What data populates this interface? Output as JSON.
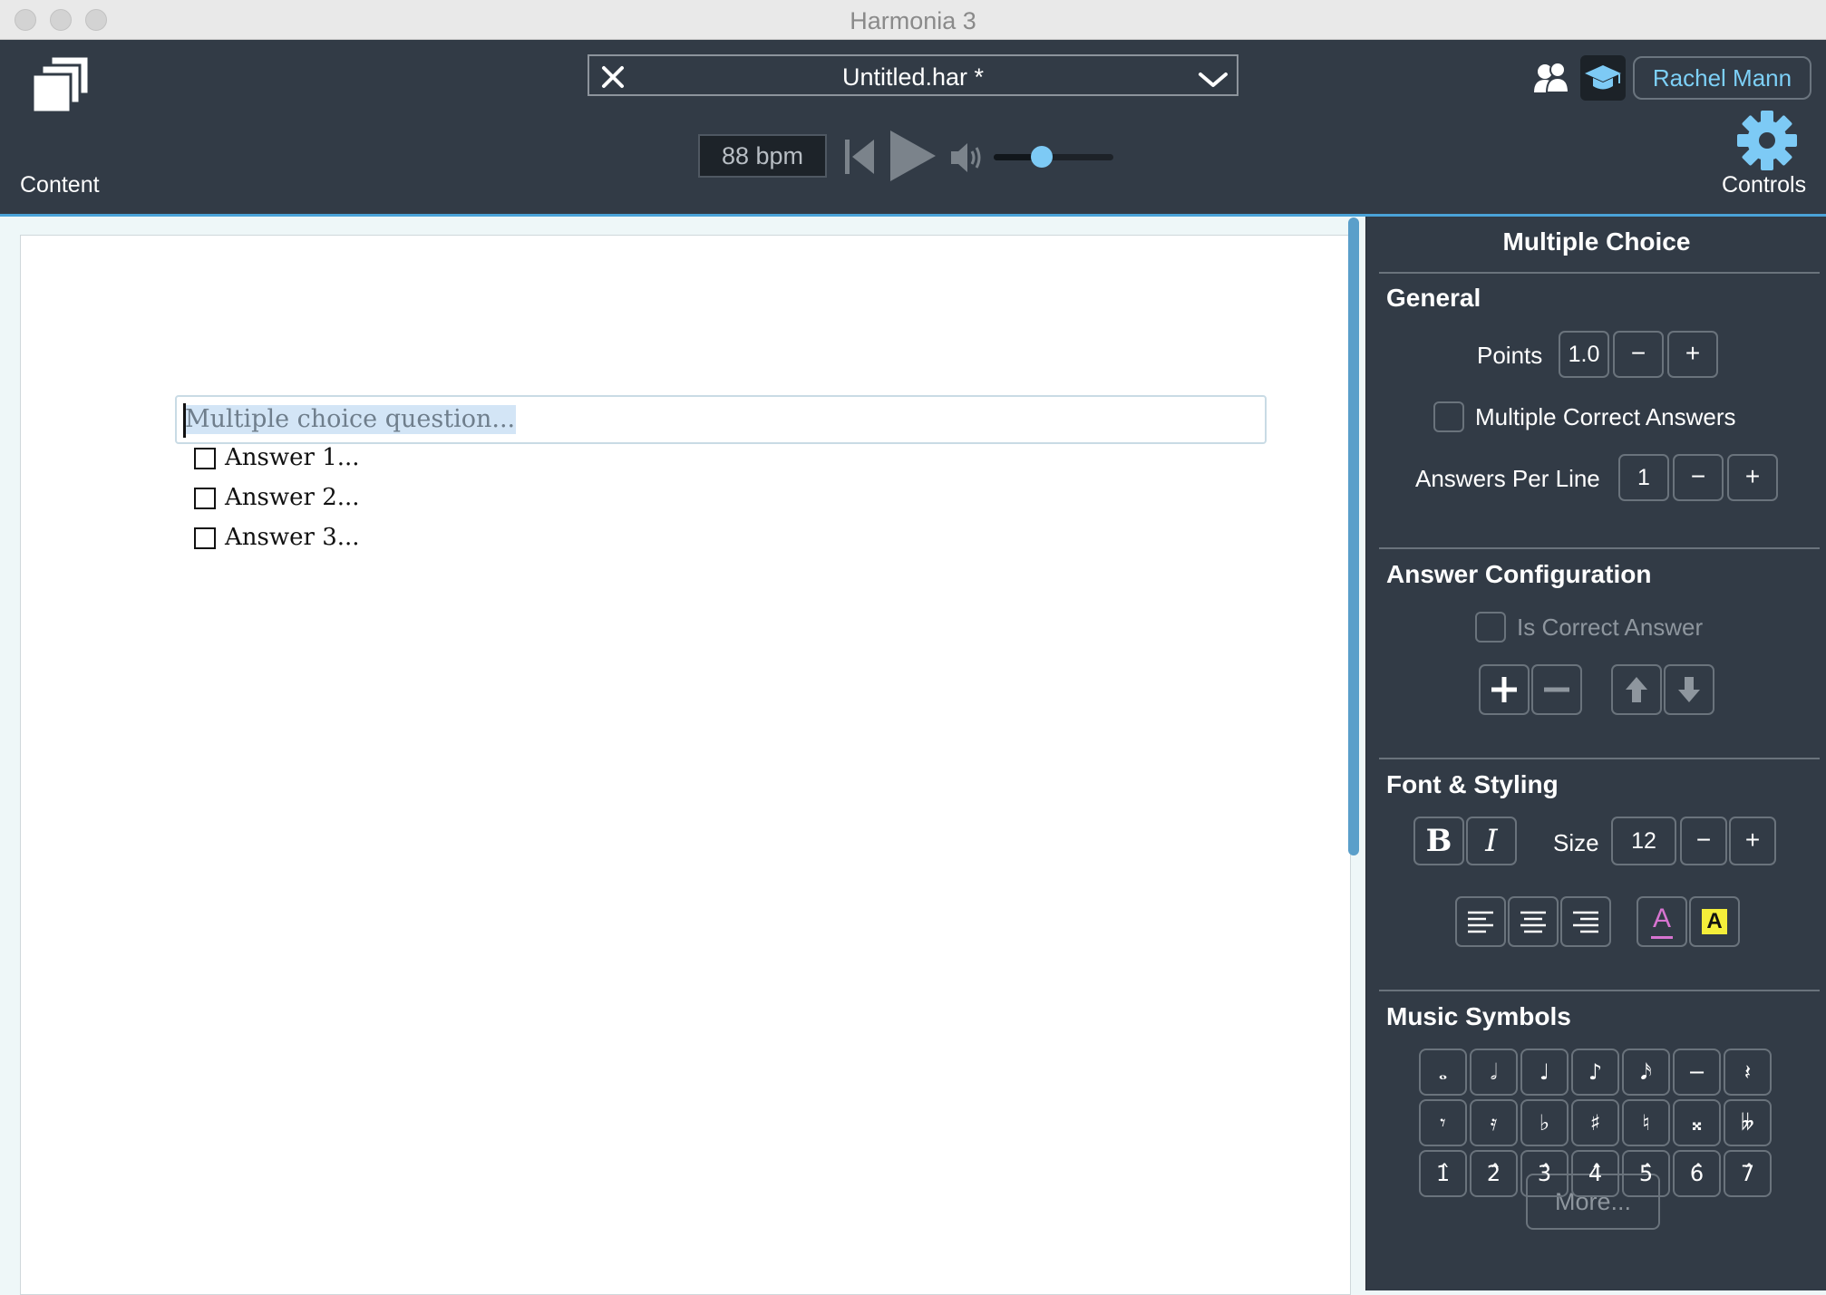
{
  "window": {
    "title": "Harmonia 3"
  },
  "toolbar": {
    "file_name": "Untitled.har *",
    "user_name": "Rachel Mann",
    "content_label": "Content",
    "controls_label": "Controls",
    "bpm": "88 bpm",
    "volume_level": 0.4
  },
  "document": {
    "question_placeholder": "Multiple choice question...",
    "answers": [
      "Answer 1...",
      "Answer 2...",
      "Answer 3..."
    ]
  },
  "panel": {
    "title": "Multiple Choice",
    "general": {
      "title": "General",
      "points_label": "Points",
      "points_value": "1.0",
      "minus": "−",
      "plus": "+",
      "multiple_correct_label": "Multiple Correct Answers",
      "answers_per_line_label": "Answers Per Line",
      "answers_per_line_value": "1"
    },
    "answer_config": {
      "title": "Answer Configuration",
      "is_correct_label": "Is Correct Answer"
    },
    "font_styling": {
      "title": "Font & Styling",
      "bold": "B",
      "italic": "I",
      "size_label": "Size",
      "size_value": "12",
      "text_color_glyph": "A",
      "highlight_glyph": "A"
    },
    "music_symbols": {
      "title": "Music Symbols",
      "more_label": "More...",
      "row1": [
        "𝅝",
        "𝅗𝅥",
        "♩",
        "♪",
        "𝅘𝅥𝅯",
        "−",
        "𝄽"
      ],
      "row2": [
        "𝄾",
        "𝄿",
        "♭",
        "♯",
        "♮",
        "𝄪",
        "𝄫"
      ],
      "row3": [
        "1̂",
        "2̂",
        "3̂",
        "4̂",
        "5̂",
        "6̂",
        "7̂"
      ]
    }
  },
  "colors": {
    "toolbar_bg": "#323b46",
    "accent_blue": "#7dcaf5",
    "text_color_pink": "#d774d0",
    "highlight_yellow": "#f4ee3a"
  }
}
